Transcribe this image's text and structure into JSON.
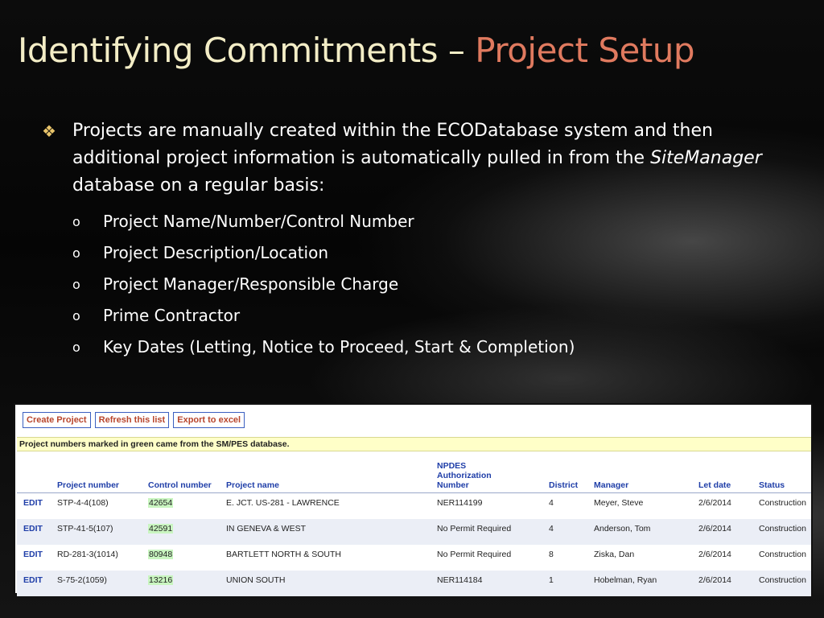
{
  "slide": {
    "title_main": "Identifying Commitments – ",
    "title_accent": "Project Setup",
    "bullet_symbol": "❖",
    "bullet_text_1": "Projects are manually created within the ECODatabase system and then additional project information is automatically pulled in from the ",
    "bullet_text_italic": "SiteManager",
    "bullet_text_2": " database on a regular basis:",
    "sub_bullet_symbol": "o",
    "sub_bullets": [
      "Project Name/Number/Control Number",
      "Project Description/Location",
      "Project Manager/Responsible Charge",
      "Prime Contractor",
      "Key Dates (Letting, Notice to Proceed, Start & Completion)"
    ],
    "colors": {
      "title": "#f3edc6",
      "accent": "#e07a5f",
      "bullet_symbol": "#e9c56b"
    }
  },
  "screenshot": {
    "buttons": {
      "create": "Create Project",
      "refresh": "Refresh this list",
      "export": "Export to excel"
    },
    "note": "Project numbers marked in green came from the SM/PES database.",
    "headers": {
      "project_number": "Project number",
      "control_number": "Control number",
      "project_name": "Project name",
      "npdes_1": "NPDES",
      "npdes_2": "Authorization",
      "npdes_3": "Number",
      "district": "District",
      "manager": "Manager",
      "let_date": "Let date",
      "status": "Status"
    },
    "rows": [
      {
        "edit": "EDIT",
        "project_number": "STP-4-4(108)",
        "control_number": "42654",
        "project_name": "E. JCT. US-281 - LAWRENCE",
        "npdes": "NER114199",
        "district": "4",
        "manager": "Meyer, Steve",
        "let_date": "2/6/2014",
        "status": "Construction"
      },
      {
        "edit": "EDIT",
        "project_number": "STP-41-5(107)",
        "control_number": "42591",
        "project_name": "IN GENEVA & WEST",
        "npdes": "No Permit Required",
        "district": "4",
        "manager": "Anderson, Tom",
        "let_date": "2/6/2014",
        "status": "Construction"
      },
      {
        "edit": "EDIT",
        "project_number": "RD-281-3(1014)",
        "control_number": "80948",
        "project_name": "BARTLETT NORTH & SOUTH",
        "npdes": "No Permit Required",
        "district": "8",
        "manager": "Ziska, Dan",
        "let_date": "2/6/2014",
        "status": "Construction"
      },
      {
        "edit": "EDIT",
        "project_number": "S-75-2(1059)",
        "control_number": "13216",
        "project_name": "UNION SOUTH",
        "npdes": "NER114184",
        "district": "1",
        "manager": "Hobelman, Ryan",
        "let_date": "2/6/2014",
        "status": "Construction"
      }
    ],
    "colors": {
      "header_text": "#1f3ea8",
      "button_text": "#b8452c",
      "note_bg": "#ffffc8",
      "green_mark": "#c9f5c0"
    }
  }
}
